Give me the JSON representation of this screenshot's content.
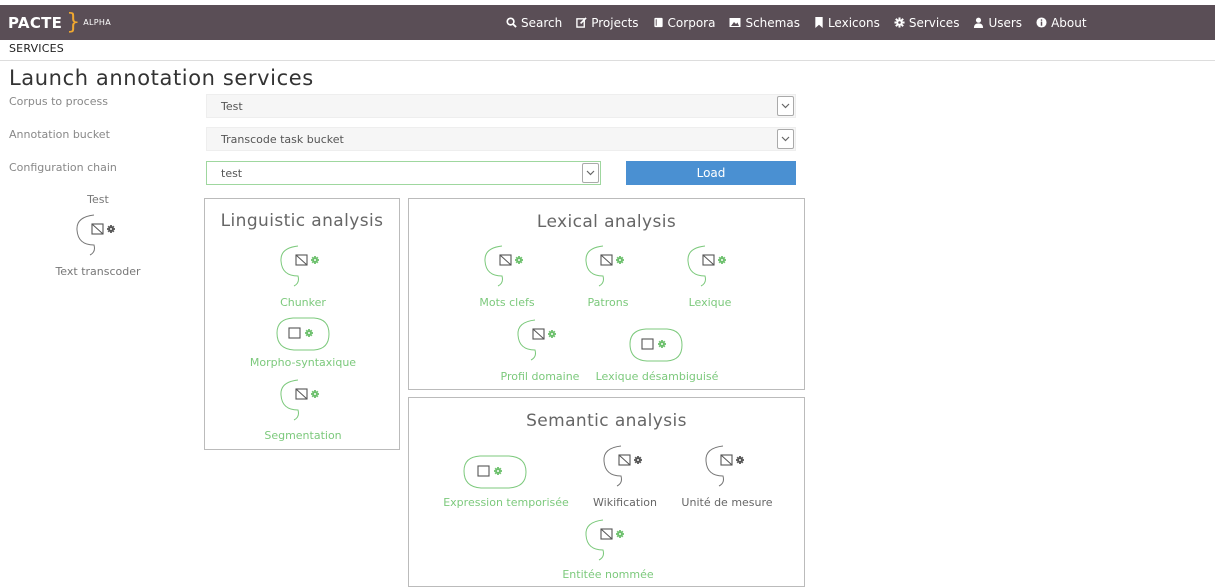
{
  "nav": {
    "brand": "PACTE",
    "brand_tag": "ALPHA",
    "items": [
      {
        "label": "Search",
        "icon": "search-icon"
      },
      {
        "label": "Projects",
        "icon": "edit-icon"
      },
      {
        "label": "Corpora",
        "icon": "book-icon"
      },
      {
        "label": "Schemas",
        "icon": "image-icon"
      },
      {
        "label": "Lexicons",
        "icon": "bookmark-icon"
      },
      {
        "label": "Services",
        "icon": "gear-icon"
      },
      {
        "label": "Users",
        "icon": "user-icon"
      },
      {
        "label": "About",
        "icon": "info-icon"
      }
    ]
  },
  "breadcrumb": "SERVICES",
  "page_title": "Launch annotation services",
  "form": {
    "corpus_label": "Corpus to process",
    "corpus_value": "Test",
    "bucket_label": "Annotation bucket",
    "bucket_value": "Transcode task bucket",
    "chain_label": "Configuration chain",
    "chain_value": "test",
    "load_label": "Load"
  },
  "chain_preview": {
    "title": "Test",
    "service": "Text transcoder"
  },
  "panels": {
    "linguistic": {
      "title": "Linguistic analysis",
      "services": [
        "Chunker",
        "Morpho-syntaxique",
        "Segmentation"
      ]
    },
    "lexical": {
      "title": "Lexical analysis",
      "services": [
        "Mots clefs",
        "Patrons",
        "Lexique",
        "Profil domaine",
        "Lexique désambiguisé"
      ]
    },
    "semantic": {
      "title": "Semantic analysis",
      "services": [
        "Expression temporisée",
        "Wikification",
        "Unité de mesure",
        "Entitée nommée"
      ]
    }
  },
  "colors": {
    "navbar": "#5a4e56",
    "brand_accent": "#f0a830",
    "available": "#7cc97c",
    "unavailable": "#666666",
    "primary_button": "#4a90d2"
  }
}
